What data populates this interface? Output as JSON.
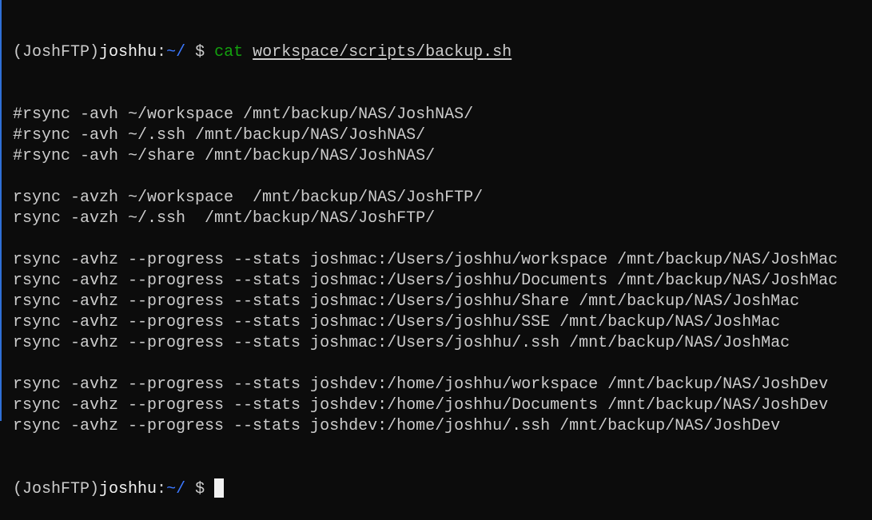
{
  "prompt": {
    "env": "(JoshFTP)",
    "user": "joshhu",
    "sep": ":",
    "cwd": "~/",
    "symbol": " $ "
  },
  "command": {
    "name": "cat",
    "arg": "workspace/scripts/backup.sh"
  },
  "output": [
    "#rsync -avh ~/workspace /mnt/backup/NAS/JoshNAS/",
    "#rsync -avh ~/.ssh /mnt/backup/NAS/JoshNAS/",
    "#rsync -avh ~/share /mnt/backup/NAS/JoshNAS/",
    "",
    "rsync -avzh ~/workspace  /mnt/backup/NAS/JoshFTP/",
    "rsync -avzh ~/.ssh  /mnt/backup/NAS/JoshFTP/",
    "",
    "rsync -avhz --progress --stats joshmac:/Users/joshhu/workspace /mnt/backup/NAS/JoshMac",
    "rsync -avhz --progress --stats joshmac:/Users/joshhu/Documents /mnt/backup/NAS/JoshMac",
    "rsync -avhz --progress --stats joshmac:/Users/joshhu/Share /mnt/backup/NAS/JoshMac",
    "rsync -avhz --progress --stats joshmac:/Users/joshhu/SSE /mnt/backup/NAS/JoshMac",
    "rsync -avhz --progress --stats joshmac:/Users/joshhu/.ssh /mnt/backup/NAS/JoshMac",
    "",
    "rsync -avhz --progress --stats joshdev:/home/joshhu/workspace /mnt/backup/NAS/JoshDev",
    "rsync -avhz --progress --stats joshdev:/home/joshhu/Documents /mnt/backup/NAS/JoshDev",
    "rsync -avhz --progress --stats joshdev:/home/joshhu/.ssh /mnt/backup/NAS/JoshDev"
  ]
}
